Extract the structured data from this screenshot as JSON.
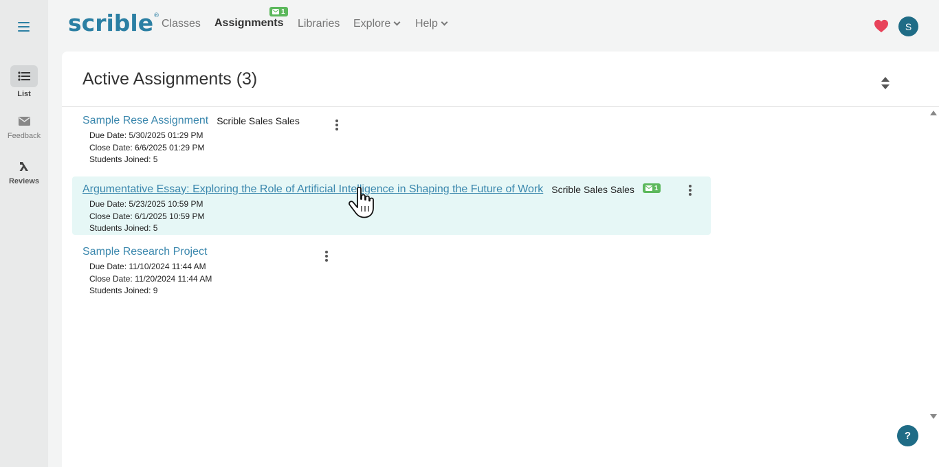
{
  "sidebar": {
    "items": [
      {
        "label": "List",
        "icon": "list-icon"
      },
      {
        "label": "Feedback",
        "icon": "envelope-icon"
      },
      {
        "label": "Reviews",
        "icon": "lambda-icon"
      }
    ]
  },
  "nav": {
    "logo": "scrible",
    "logo_mark": "®",
    "classes": "Classes",
    "assignments": "Assignments",
    "assignments_badge": "1",
    "libraries": "Libraries",
    "explore": "Explore",
    "help": "Help",
    "avatar_initial": "S"
  },
  "page": {
    "title": "Active Assignments (3)"
  },
  "assignments": [
    {
      "title": "Sample Rese Assignment",
      "owner": "Scrible Sales Sales",
      "due": "Due Date: 5/30/2025 01:29 PM",
      "close": "Close Date: 6/6/2025 01:29 PM",
      "students": "Students Joined: 5"
    },
    {
      "title": "Argumentative Essay: Exploring the Role of Artificial Intelligence in Shaping the Future of Work",
      "owner": "Scrible Sales Sales",
      "badge": "1",
      "due": "Due Date: 5/23/2025 10:59 PM",
      "close": "Close Date: 6/1/2025 10:59 PM",
      "students": "Students Joined: 5"
    },
    {
      "title": "Sample Research Project",
      "due": "Due Date: 11/10/2024 11:44 AM",
      "close": "Close Date: 11/20/2024 11:44 AM",
      "students": "Students Joined: 9"
    }
  ],
  "help_button": "?",
  "colors": {
    "brand": "#2b7fa3",
    "badge_green": "#5cb85c",
    "avatar": "#1f6c86",
    "heart": "#e8435a",
    "highlight_row": "#e6f7f6"
  }
}
